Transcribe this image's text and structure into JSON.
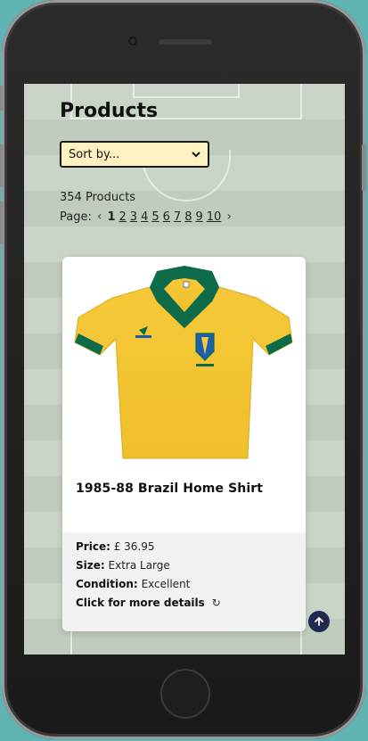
{
  "page": {
    "title": "Products"
  },
  "sort": {
    "selected": "Sort by...",
    "options": [
      "Sort by..."
    ]
  },
  "products": {
    "count_text": "354 Products"
  },
  "pagination": {
    "label": "Page:",
    "current": "1",
    "pages": [
      "1",
      "2",
      "3",
      "4",
      "5",
      "6",
      "7",
      "8",
      "9",
      "10"
    ]
  },
  "card": {
    "title": "1985-88 Brazil Home Shirt",
    "price_label": "Price:",
    "price_value": "£ 36.95",
    "size_label": "Size:",
    "size_value": "Extra Large",
    "condition_label": "Condition:",
    "condition_value": "Excellent",
    "details_text": "Click for more details"
  },
  "icons": {
    "prev": "chevron-left-icon",
    "next": "chevron-right-icon",
    "dropdown": "chevron-down-icon",
    "refresh": "refresh-icon",
    "scroll_top": "arrow-up-icon"
  },
  "colors": {
    "sort_bg": "#fff1c1",
    "shirt_yellow": "#f4c531",
    "shirt_green": "#0e6b4a",
    "scroll_btn": "#1f2a4e"
  }
}
